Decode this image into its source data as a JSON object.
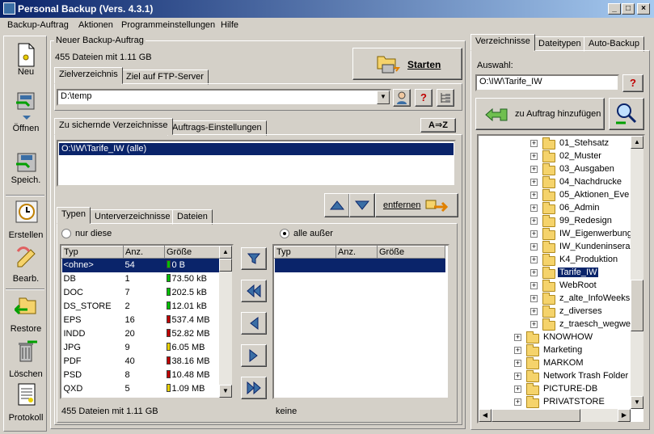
{
  "window": {
    "title": "Personal Backup (Vers. 4.3.1)"
  },
  "menu": [
    "Backup-Auftrag",
    "Aktionen",
    "Programmeinstellungen",
    "Hilfe"
  ],
  "toolbar": {
    "new": "Neu",
    "open": "Öffnen",
    "save": "Speich.",
    "create": "Erstellen",
    "edit": "Bearb.",
    "restore": "Restore",
    "delete": "Löschen",
    "log": "Protokoll"
  },
  "job": {
    "group_title": "Neuer Backup-Auftrag",
    "summary": "455 Dateien mit 1.11 GB",
    "start_label": "Starten",
    "tabs": [
      "Zielverzeichnis",
      "Ziel auf FTP-Server"
    ],
    "target_path": "D:\\temp"
  },
  "dirs": {
    "tabs": [
      "Zu sichernde Verzeichnisse",
      "Auftrags-Einstellungen"
    ],
    "az_label": "A⇒Z",
    "items": [
      "O:\\IW\\Tarife_IW (alle)"
    ],
    "remove_label": "entfernen"
  },
  "types": {
    "tabs": [
      "Typen",
      "Unterverzeichnisse",
      "Dateien"
    ],
    "radio_only": "nur diese",
    "radio_except": "alle außer",
    "columns": [
      "Typ",
      "Anz.",
      "Größe"
    ],
    "rows": [
      {
        "type": "<ohne>",
        "count": "54",
        "size": "0 B",
        "level": "green"
      },
      {
        "type": "DB",
        "count": "1",
        "size": "73.50 kB",
        "level": "green"
      },
      {
        "type": "DOC",
        "count": "7",
        "size": "202.5 kB",
        "level": "green"
      },
      {
        "type": "DS_STORE",
        "count": "2",
        "size": "12.01 kB",
        "level": "green"
      },
      {
        "type": "EPS",
        "count": "16",
        "size": "537.4 MB",
        "level": "red"
      },
      {
        "type": "INDD",
        "count": "20",
        "size": "52.82 MB",
        "level": "red"
      },
      {
        "type": "JPG",
        "count": "9",
        "size": "6.05 MB",
        "level": "yellow"
      },
      {
        "type": "PDF",
        "count": "40",
        "size": "38.16 MB",
        "level": "red"
      },
      {
        "type": "PSD",
        "count": "8",
        "size": "10.48 MB",
        "level": "red"
      },
      {
        "type": "QXD",
        "count": "5",
        "size": "1.09 MB",
        "level": "yellow"
      }
    ],
    "right_columns": [
      "Typ",
      "Anz.",
      "Größe"
    ],
    "left_footer": "455 Dateien mit 1.11 GB",
    "right_footer": "keine"
  },
  "right": {
    "tabs": [
      "Verzeichnisse",
      "Dateitypen",
      "Auto-Backup"
    ],
    "selection_label": "Auswahl:",
    "selection_value": "O:\\IW\\Tarife_IW",
    "add_label": "zu Auftrag hinzufügen",
    "tree": [
      {
        "label": "01_Stehsatz",
        "depth": 1,
        "selected": false
      },
      {
        "label": "02_Muster",
        "depth": 1,
        "selected": false
      },
      {
        "label": "03_Ausgaben",
        "depth": 1,
        "selected": false
      },
      {
        "label": "04_Nachdrucke",
        "depth": 1,
        "selected": false
      },
      {
        "label": "05_Aktionen_Eve",
        "depth": 1,
        "selected": false
      },
      {
        "label": "06_Admin",
        "depth": 1,
        "selected": false
      },
      {
        "label": "99_Redesign",
        "depth": 1,
        "selected": false
      },
      {
        "label": "IW_Eigenwerbung",
        "depth": 1,
        "selected": false
      },
      {
        "label": "IW_Kundeninsera",
        "depth": 1,
        "selected": false
      },
      {
        "label": "K4_Produktion",
        "depth": 1,
        "selected": false
      },
      {
        "label": "Tarife_IW",
        "depth": 1,
        "selected": true
      },
      {
        "label": "WebRoot",
        "depth": 1,
        "selected": false
      },
      {
        "label": "z_alte_InfoWeeks",
        "depth": 1,
        "selected": false
      },
      {
        "label": "z_diverses",
        "depth": 1,
        "selected": false
      },
      {
        "label": "z_traesch_wegwe",
        "depth": 1,
        "selected": false
      },
      {
        "label": "KNOWHOW",
        "depth": 0,
        "selected": false
      },
      {
        "label": "Marketing",
        "depth": 0,
        "selected": false
      },
      {
        "label": "MARKOM",
        "depth": 0,
        "selected": false
      },
      {
        "label": "Network Trash Folder",
        "depth": 0,
        "selected": false
      },
      {
        "label": "PICTURE-DB",
        "depth": 0,
        "selected": false
      },
      {
        "label": "PRIVATSTORE",
        "depth": 0,
        "selected": false
      }
    ]
  },
  "colors": {
    "selection": "#0a246a",
    "face": "#d4d0c8",
    "green": "#00c000",
    "red": "#c00000",
    "yellow": "#e8d000"
  }
}
